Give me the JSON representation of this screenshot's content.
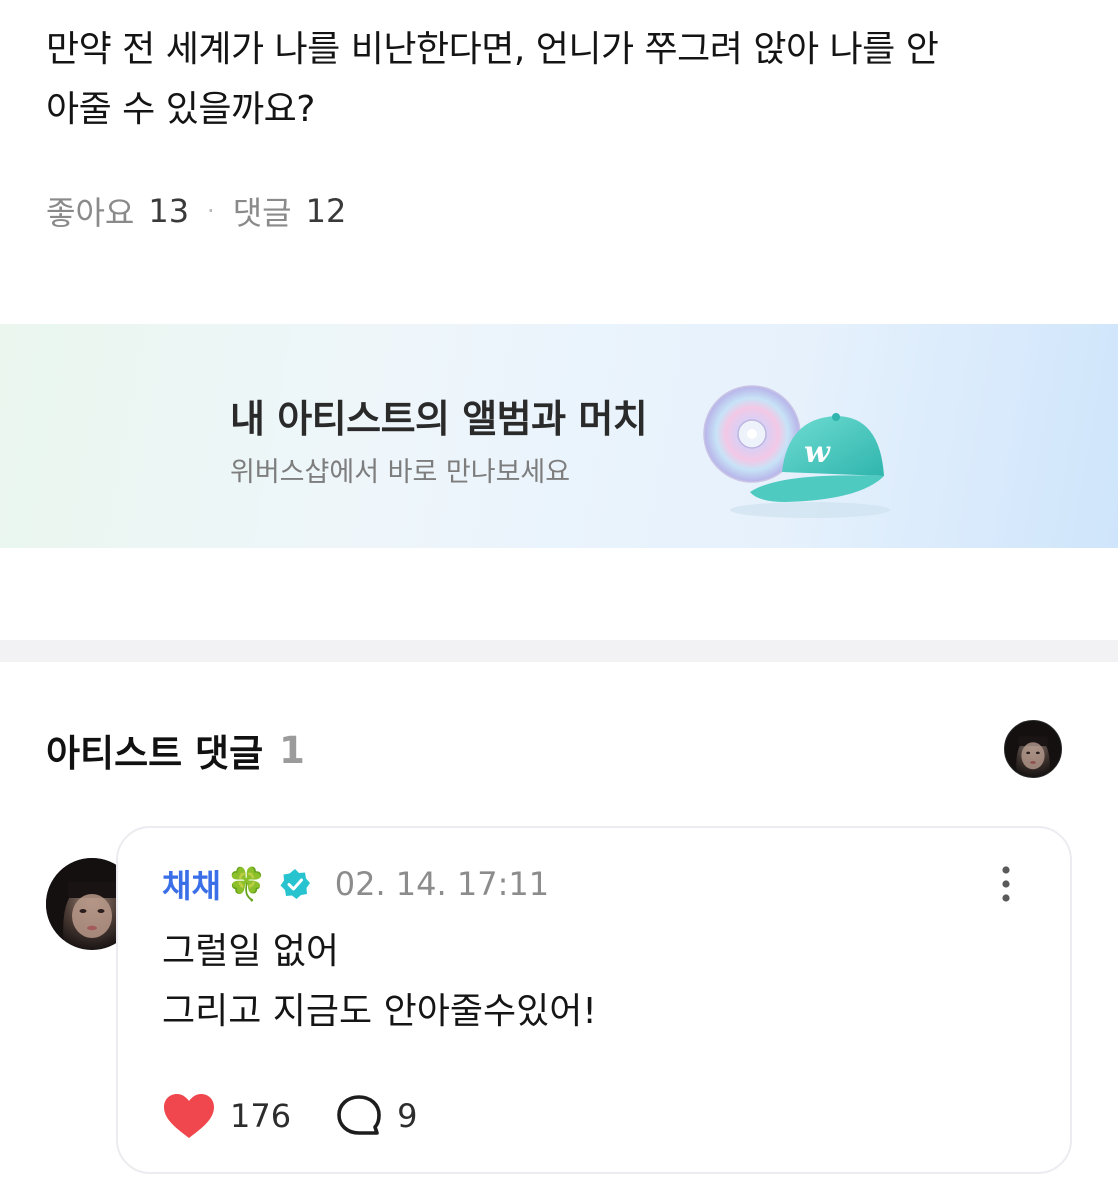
{
  "post": {
    "lines": [
      "만약 전 세계가 나를 비난한다면, 언니가 쭈그려 앉아 나를 안",
      "아줄 수 있을까요?"
    ],
    "likes_label": "좋아요",
    "likes_count": "13",
    "separator": "·",
    "comments_label": "댓글",
    "comments_count": "12"
  },
  "banner": {
    "title": "내 아티스트의 앨범과 머치",
    "subtitle": "위버스샵에서 바로 만나보세요",
    "icons": [
      "cd-icon",
      "cap-icon"
    ]
  },
  "artist_comments": {
    "heading": "아티스트 댓글",
    "count": "1",
    "comment": {
      "author": "채채",
      "author_emoji": "🍀",
      "verified": true,
      "timestamp": "02. 14. 17:11",
      "body_lines": [
        "그럴일 없어",
        "그리고 지금도 안아줄수있어!"
      ],
      "likes": "176",
      "replies": "9"
    }
  },
  "colors": {
    "author": "#3a6fe8",
    "verified_badge": "#27c4cf",
    "heart": "#f0474e",
    "muted_text": "#8a8a8a",
    "divider": "#f2f2f4"
  }
}
